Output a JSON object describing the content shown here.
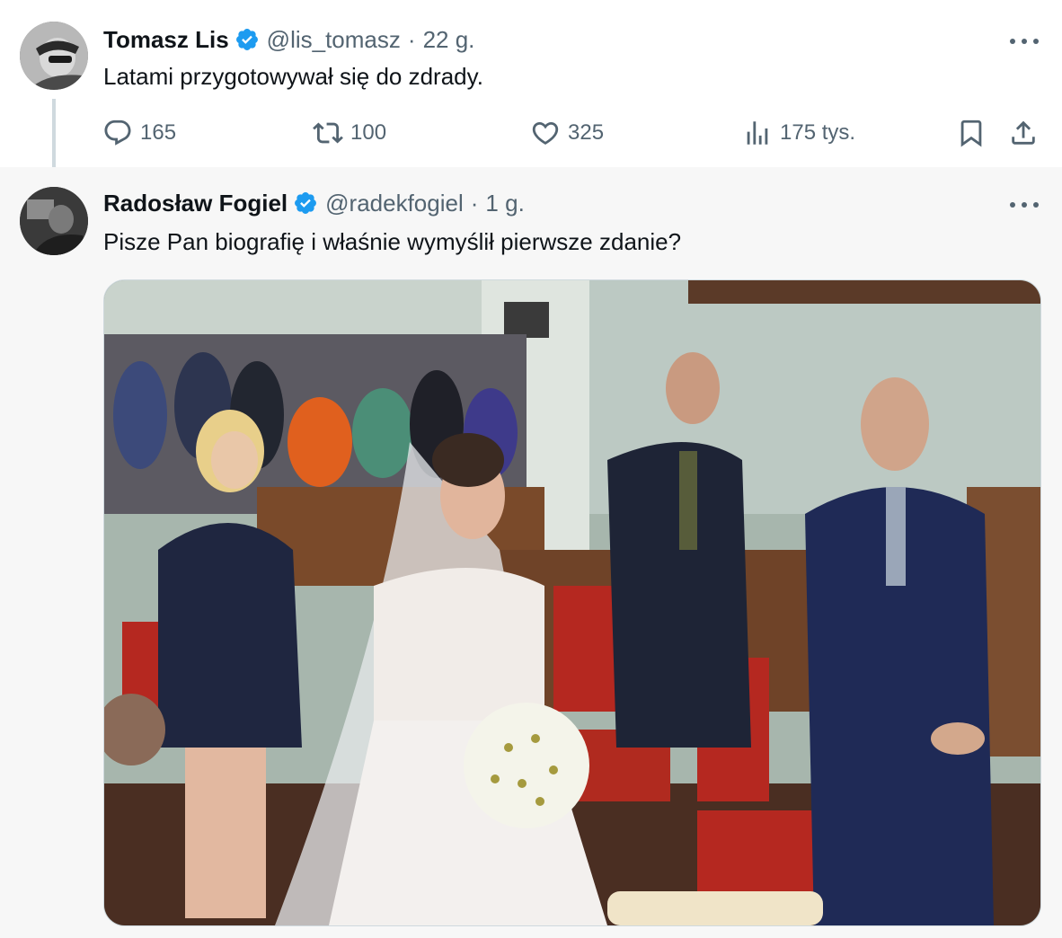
{
  "tweets": [
    {
      "author_name": "Tomasz Lis",
      "handle": "@lis_tomasz",
      "separator": "·",
      "time": "22 g.",
      "text": "Latami przygotowywał się do zdrady.",
      "metrics": {
        "replies": "165",
        "retweets": "100",
        "likes": "325",
        "views": "175 tys."
      }
    },
    {
      "author_name": "Radosław Fogiel",
      "handle": "@radekfogiel",
      "separator": "·",
      "time": "1 g.",
      "text": "Pisze Pan biografię i właśnie wymyślił pierwsze zdanie?"
    }
  ],
  "icons": {
    "verified": "verified-badge-icon",
    "more": "more-horizontal-icon",
    "reply": "reply-icon",
    "retweet": "retweet-icon",
    "like": "heart-icon",
    "views": "views-chart-icon",
    "bookmark": "bookmark-icon",
    "share": "share-icon"
  },
  "colors": {
    "verified_blue": "#1d9bf0",
    "secondary_text": "#536471",
    "primary_text": "#0f1419",
    "quoted_background": "#f7f7f7"
  }
}
